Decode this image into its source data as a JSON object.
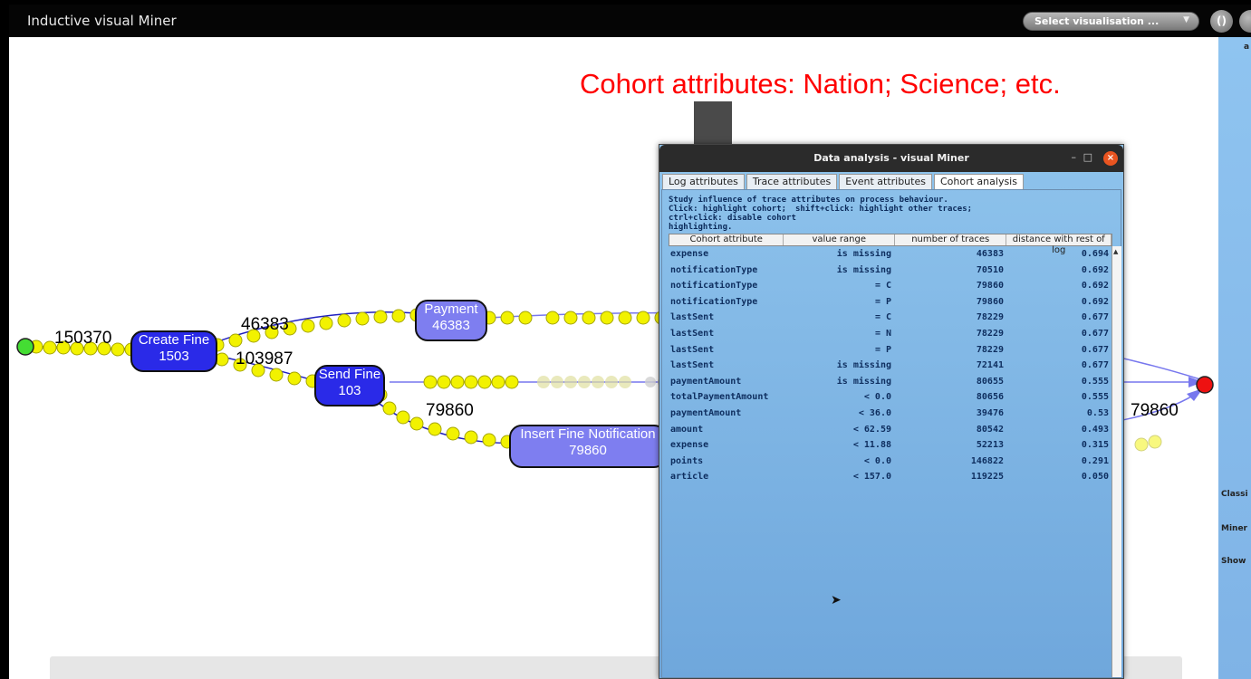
{
  "app": {
    "title": "Inductive visual Miner",
    "vis_select_label": "Select visualisation ...",
    "vis_select_arrow": "▼",
    "btn1_label": "()"
  },
  "annotation": "Cohort attributes: Nation; Science; etc.",
  "colors": {
    "annotation": "#ff0000",
    "node_dark": "#2a2ae8",
    "node_light": "#7e7ef0",
    "token": "#f2f200",
    "start": "#44dd33",
    "end": "#ee1111"
  },
  "model": {
    "labels": {
      "l150370": "150370",
      "l46383": "46383",
      "l103987": "103987",
      "l79860": "79860",
      "l79860b": "79860"
    },
    "nodes": {
      "create": {
        "name": "Create Fine",
        "count": "1503"
      },
      "send": {
        "name": "Send Fine",
        "count": "103"
      },
      "payment": {
        "name": "Payment",
        "count": "46383"
      },
      "insert": {
        "name": "Insert Fine Notification",
        "count": "79860"
      }
    }
  },
  "right_panel": {
    "top": "a",
    "classifier": "Classi",
    "miner": "Miner",
    "show": "Show"
  },
  "dialog": {
    "title": "Data analysis - visual Miner",
    "minimize": "–",
    "maximize": "□",
    "close": "×",
    "tabs": [
      "Log attributes",
      "Trace attributes",
      "Event attributes",
      "Cohort analysis"
    ],
    "instructions": {
      "line1": "Study influence of trace attributes on process behaviour.",
      "click": "Click: highlight cohort;",
      "shift": "shift+click: highlight other traces;",
      "ctrl": "ctrl+click: disable cohort",
      "line3": "highlighting."
    },
    "table": {
      "headers": [
        "Cohort attribute",
        "value range",
        "number of traces",
        "distance with rest of log"
      ],
      "rows": [
        [
          "expense",
          "is missing",
          "46383",
          "0.694"
        ],
        [
          "notificationType",
          "is missing",
          "70510",
          "0.692"
        ],
        [
          "notificationType",
          "= C",
          "79860",
          "0.692"
        ],
        [
          "notificationType",
          "= P",
          "79860",
          "0.692"
        ],
        [
          "lastSent",
          "= C",
          "78229",
          "0.677"
        ],
        [
          "lastSent",
          "= N",
          "78229",
          "0.677"
        ],
        [
          "lastSent",
          "= P",
          "78229",
          "0.677"
        ],
        [
          "lastSent",
          "is missing",
          "72141",
          "0.677"
        ],
        [
          "paymentAmount",
          "is missing",
          "80655",
          "0.555"
        ],
        [
          "totalPaymentAmount",
          "< 0.0",
          "80656",
          "0.555"
        ],
        [
          "paymentAmount",
          "< 36.0",
          "39476",
          "0.53"
        ],
        [
          "amount",
          "< 62.59",
          "80542",
          "0.493"
        ],
        [
          "expense",
          "< 11.88",
          "52213",
          "0.315"
        ],
        [
          "points",
          "< 0.0",
          "146822",
          "0.291"
        ],
        [
          "article",
          "< 157.0",
          "119225",
          "0.050"
        ]
      ]
    },
    "scroll_up": "▲"
  }
}
